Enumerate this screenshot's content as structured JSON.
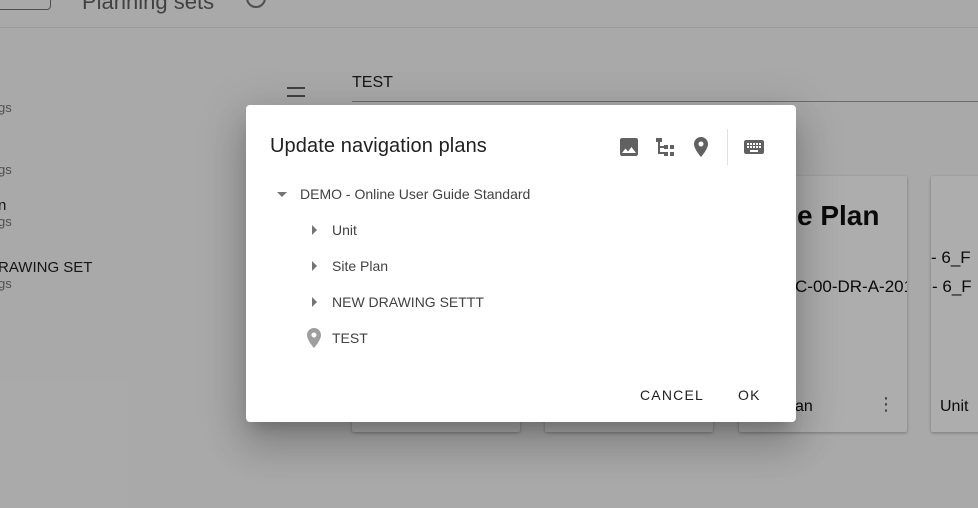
{
  "background": {
    "page_title": "Planning sets",
    "sidebar": [
      {
        "name": "",
        "sub": "gs"
      },
      {
        "name": "",
        "sub": "gs"
      },
      {
        "name": "n",
        "sub": "gs"
      },
      {
        "name": "RAWING SET",
        "sub": "gs"
      }
    ],
    "name_field_value": "TEST",
    "cards": [
      {
        "big": "e Plan",
        "mid": "C-00-DR-A-201",
        "foot": "an"
      },
      {
        "mid1": "- 6_F",
        "mid2": "- 6_F",
        "foot": "Unit"
      }
    ]
  },
  "dialog": {
    "title": "Update navigation plans",
    "toolbar": {
      "image_icon": "image-icon",
      "tree_icon": "tree-structure-icon",
      "location_icon": "location-pin-icon",
      "keyboard_icon": "keyboard-icon"
    },
    "tree": {
      "root": {
        "label": "DEMO - Online User Guide Standard",
        "expanded": true
      },
      "children": [
        {
          "label": "Unit",
          "type": "folder"
        },
        {
          "label": "Site Plan",
          "type": "folder"
        },
        {
          "label": "NEW DRAWING SETTT",
          "type": "folder"
        },
        {
          "label": "TEST",
          "type": "location"
        }
      ]
    },
    "buttons": {
      "cancel": "CANCEL",
      "ok": "OK"
    }
  },
  "colors": {
    "scrim": "#000000",
    "icon": "#616161",
    "text": "#212121"
  }
}
